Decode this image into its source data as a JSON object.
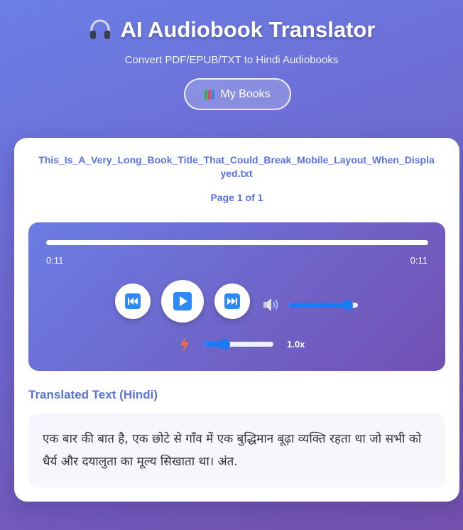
{
  "header": {
    "icon": "headphones-icon",
    "title": "AI Audiobook Translator",
    "subtitle": "Convert PDF/EPUB/TXT to Hindi Audiobooks",
    "my_books_label": "My Books",
    "my_books_icon": "books-icon"
  },
  "book": {
    "filename": "This_Is_A_Very_Long_Book_Title_That_Could_Break_Mobile_Layout_When_Displayed.txt",
    "page_indicator": "Page 1 of 1"
  },
  "player": {
    "current_time": "0:11",
    "total_time": "0:11",
    "progress": 1.0,
    "volume": 0.85,
    "speed_value": 0.3,
    "speed_label": "1.0x",
    "icons": {
      "rewind": "rewind-icon",
      "play": "play-icon",
      "forward": "fast-forward-icon",
      "volume": "speaker-icon",
      "speed": "lightning-icon"
    }
  },
  "translation": {
    "heading": "Translated Text (Hindi)",
    "text": "एक बार की बात है, एक छोटे से गाँव में एक बुद्धिमान बूढ़ा व्यक्ति रहता था जो सभी को धैर्य और दयालुता का मूल्य सिखाता था। अंत."
  },
  "colors": {
    "accent": "#5b73d9",
    "slider": "#1a7cf5",
    "control_icon": "#2c8af7"
  }
}
